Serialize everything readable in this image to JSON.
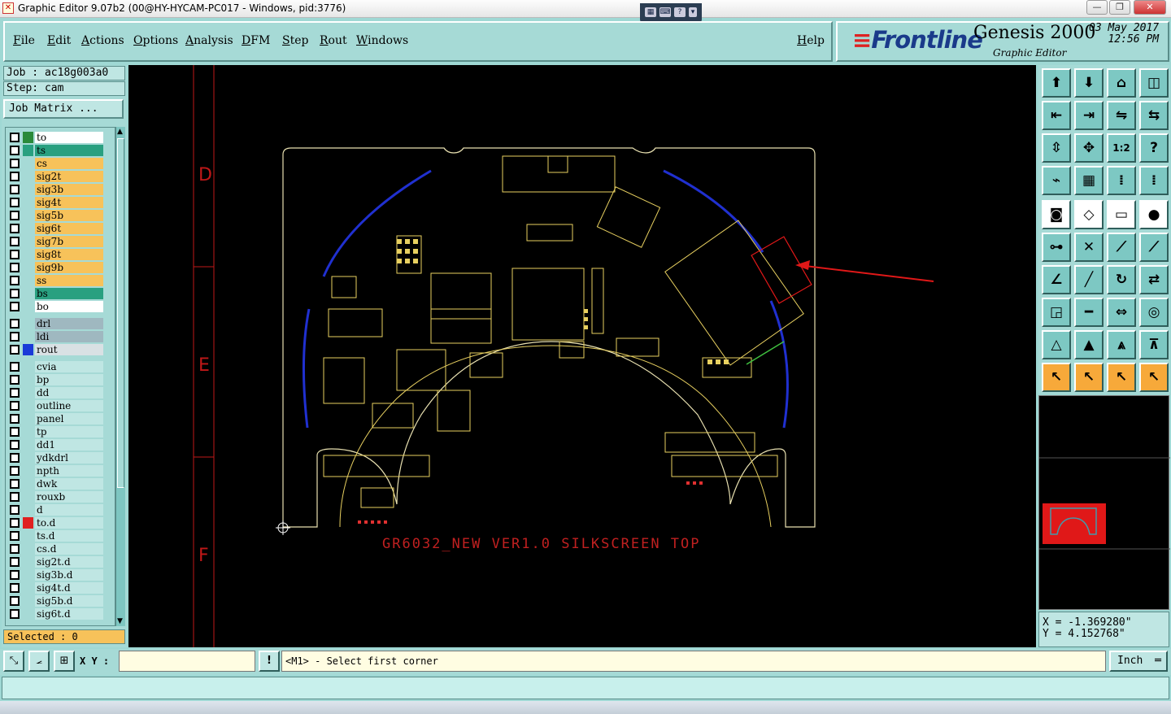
{
  "window": {
    "title": "Graphic Editor 9.07b2 (00@HY-HYCAM-PC017 - Windows, pid:3776)",
    "minimize": "—",
    "restore": "❐",
    "close": "✕"
  },
  "menu": {
    "items": [
      "File",
      "Edit",
      "Actions",
      "Options",
      "Analysis",
      "DFM",
      "Step",
      "Rout",
      "Windows"
    ],
    "help": "Help"
  },
  "brand": {
    "logo": "Frontline",
    "product": "Genesis 2000",
    "subtitle": "Graphic Editor",
    "date": "03 May 2017",
    "time": "12:56 PM"
  },
  "job": {
    "job_label": "Job : ac18g003a0",
    "step_label": "Step: cam",
    "matrix_button": "Job Matrix ..."
  },
  "layers": [
    {
      "name": "to",
      "color": "#ffffff",
      "swatch": "#2a8a3a"
    },
    {
      "name": "ts",
      "color": "#29a080",
      "swatch": "#29a080"
    },
    {
      "name": "cs",
      "color": "#f7c25a",
      "swatch": "#a6dad6"
    },
    {
      "name": "sig2t",
      "color": "#f7c25a",
      "swatch": "#a6dad6"
    },
    {
      "name": "sig3b",
      "color": "#f7c25a",
      "swatch": "#a6dad6"
    },
    {
      "name": "sig4t",
      "color": "#f7c25a",
      "swatch": "#a6dad6"
    },
    {
      "name": "sig5b",
      "color": "#f7c25a",
      "swatch": "#a6dad6"
    },
    {
      "name": "sig6t",
      "color": "#f7c25a",
      "swatch": "#a6dad6"
    },
    {
      "name": "sig7b",
      "color": "#f7c25a",
      "swatch": "#a6dad6"
    },
    {
      "name": "sig8t",
      "color": "#f7c25a",
      "swatch": "#a6dad6"
    },
    {
      "name": "sig9b",
      "color": "#f7c25a",
      "swatch": "#a6dad6"
    },
    {
      "name": "ss",
      "color": "#f7c25a",
      "swatch": "#a6dad6"
    },
    {
      "name": "bs",
      "color": "#29a080",
      "swatch": "#a6dad6"
    },
    {
      "name": "bo",
      "color": "#ffffff",
      "swatch": "#a6dad6"
    },
    {
      "name": "drl",
      "color": "#9fb8c0",
      "swatch": "#a6dad6"
    },
    {
      "name": "ldi",
      "color": "#9fb8c0",
      "swatch": "#a6dad6"
    },
    {
      "name": "rout",
      "color": "#d9e1e4",
      "swatch": "#1a3ad8"
    },
    {
      "name": "cvia",
      "color": "#bfe6e3",
      "swatch": "#a6dad6"
    },
    {
      "name": "bp",
      "color": "#bfe6e3",
      "swatch": "#a6dad6"
    },
    {
      "name": "dd",
      "color": "#bfe6e3",
      "swatch": "#a6dad6"
    },
    {
      "name": "outline",
      "color": "#bfe6e3",
      "swatch": "#a6dad6"
    },
    {
      "name": "panel",
      "color": "#bfe6e3",
      "swatch": "#a6dad6"
    },
    {
      "name": "tp",
      "color": "#bfe6e3",
      "swatch": "#a6dad6"
    },
    {
      "name": "dd1",
      "color": "#bfe6e3",
      "swatch": "#a6dad6"
    },
    {
      "name": "ydkdrl",
      "color": "#bfe6e3",
      "swatch": "#a6dad6"
    },
    {
      "name": "npth",
      "color": "#bfe6e3",
      "swatch": "#a6dad6"
    },
    {
      "name": "dwk",
      "color": "#bfe6e3",
      "swatch": "#a6dad6"
    },
    {
      "name": "rouxb",
      "color": "#bfe6e3",
      "swatch": "#a6dad6"
    },
    {
      "name": "d",
      "color": "#bfe6e3",
      "swatch": "#a6dad6"
    },
    {
      "name": "to.d",
      "color": "#bfe6e3",
      "swatch": "#e02020"
    },
    {
      "name": "ts.d",
      "color": "#bfe6e3",
      "swatch": "#a6dad6"
    },
    {
      "name": "cs.d",
      "color": "#bfe6e3",
      "swatch": "#a6dad6"
    },
    {
      "name": "sig2t.d",
      "color": "#bfe6e3",
      "swatch": "#a6dad6"
    },
    {
      "name": "sig3b.d",
      "color": "#bfe6e3",
      "swatch": "#a6dad6"
    },
    {
      "name": "sig4t.d",
      "color": "#bfe6e3",
      "swatch": "#a6dad6"
    },
    {
      "name": "sig5b.d",
      "color": "#bfe6e3",
      "swatch": "#a6dad6"
    },
    {
      "name": "sig6t.d",
      "color": "#bfe6e3",
      "swatch": "#a6dad6"
    }
  ],
  "selected_label": "Selected : 0",
  "canvas": {
    "grid_letters": [
      "D",
      "E",
      "F"
    ],
    "board_label": "GR6032_NEW VER1.0 SILKSCREEN TOP",
    "grid_color": "#c01818",
    "outline_color": "#e8e0b0",
    "silk_color": "#e8d060",
    "rout_color": "#2030d0",
    "arrow_color": "#e01818"
  },
  "coords": {
    "x": "X = -1.369280\"",
    "y": "Y = 4.152768\""
  },
  "bottom": {
    "xy_label": "X Y :",
    "xy_value": "",
    "prompt": "<M1> - Select first corner",
    "unit": "Inch"
  }
}
